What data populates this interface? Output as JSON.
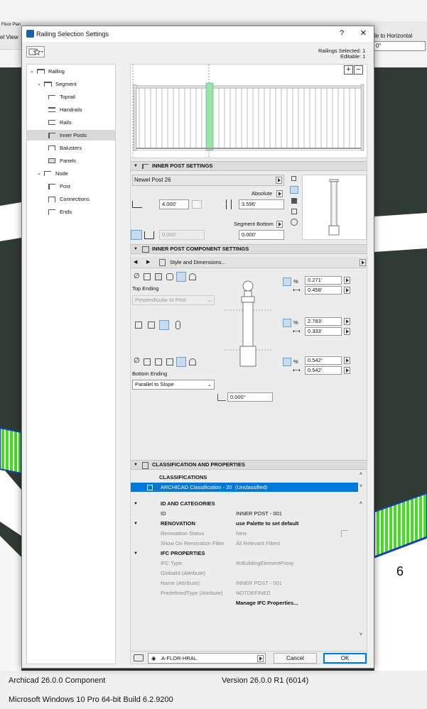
{
  "background": {
    "toolbar_labels": [
      "Floor Plan",
      "el View"
    ],
    "right_button": "le to Horizontal",
    "right_field": "0°",
    "canvas_marker": "6"
  },
  "dialog": {
    "title": "Railing Selection Settings",
    "help_label": "?",
    "close_label": "×",
    "railings_selected": "Railings Selected: 1",
    "editable": "Editable: 1"
  },
  "tree": {
    "items": [
      {
        "label": "Railing"
      },
      {
        "label": "Segment"
      },
      {
        "label": "Toprail"
      },
      {
        "label": "Handrails"
      },
      {
        "label": "Rails"
      },
      {
        "label": "Inner Posts"
      },
      {
        "label": "Balusters"
      },
      {
        "label": "Panels"
      },
      {
        "label": "Node"
      },
      {
        "label": "Post"
      },
      {
        "label": "Connections"
      },
      {
        "label": "Ends"
      }
    ]
  },
  "preview": {
    "zoom_in": "+",
    "zoom_out": "−"
  },
  "inner_post": {
    "heading": "INNER POST SETTINGS",
    "object_name": "Newel Post 26",
    "absolute_label": "Absolute",
    "width_value": "4.000'",
    "height_value": "3.596'",
    "segment_bottom_label": "Segment Bottom",
    "offset_value": "0.000'",
    "segment_bottom_value": "0.000'"
  },
  "component": {
    "heading": "INNER POST COMPONENT SETTINGS",
    "page_label": "Style and Dimensions...",
    "top_ending_label": "Top Ending",
    "top_ending_value": "Perpendicular to Post",
    "bottom_ending_label": "Bottom Ending",
    "bottom_ending_value": "Parallel to Slope",
    "top_pct": "0.271'",
    "top_width": "0.458'",
    "mid_pct": "2.783'",
    "mid_width": "0.333'",
    "bot_pct": "0.542'",
    "bot_width": "0.542'",
    "angle_value": "0.000°",
    "percent_symbol": "%"
  },
  "classification": {
    "heading": "CLASSIFICATION AND PROPERTIES",
    "classifications_label": "CLASSIFICATIONS",
    "selected_row": "ARCHICAD Classification - 20",
    "selected_row_value": "(Unclassified)",
    "rows": [
      {
        "name": "ID AND CATEGORIES",
        "value": "",
        "type": "group"
      },
      {
        "name": "ID",
        "value": "INNER POST - 001",
        "type": "normal"
      },
      {
        "name": "RENOVATION",
        "value": "use Palette to set default",
        "type": "group"
      },
      {
        "name": "Renovation Status",
        "value": "New",
        "type": "grey"
      },
      {
        "name": "Show On Renovation Filter",
        "value": "All Relevant Filters",
        "type": "grey"
      },
      {
        "name": "IFC PROPERTIES",
        "value": "",
        "type": "group"
      },
      {
        "name": "IFC Type",
        "value": "IfcBuildingElementProxy",
        "type": "grey"
      },
      {
        "name": "GlobalId (Attribute)",
        "value": "",
        "type": "grey"
      },
      {
        "name": "Name (Attribute)",
        "value": "INNER POST - 001",
        "type": "grey"
      },
      {
        "name": "PredefinedType (Attribute)",
        "value": "NOTDEFINED",
        "type": "grey"
      },
      {
        "name": "",
        "value": "Manage IFC Properties...",
        "type": "bold"
      }
    ]
  },
  "footer": {
    "layer": "A-FLOR-HRAL",
    "cancel": "Cancel",
    "ok": "OK"
  },
  "status": {
    "product": "Archicad 26.0.0 Component",
    "version": "Version 26.0.0 R1 (6014)",
    "os": "Microsoft Windows 10 Pro 64-bit Build 6.2.9200"
  },
  "colors": {
    "selection_blue": "#0078d7",
    "green_highlight": "#9be4a6",
    "hatch_green": "#44dd22",
    "canvas_dark": "#2f3b33"
  }
}
